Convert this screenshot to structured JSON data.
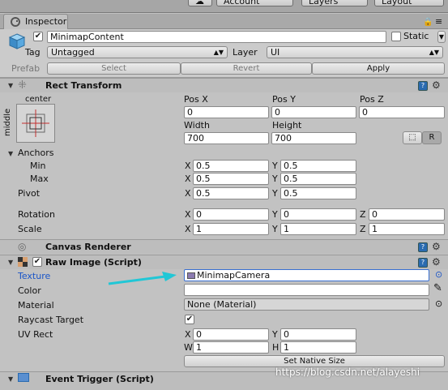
{
  "topbar": {
    "account": "Account",
    "layers": "Layers",
    "layout": "Layout"
  },
  "tab": {
    "label": "Inspector"
  },
  "header": {
    "object_name": "MinimapContent",
    "static_label": "Static",
    "tag_label": "Tag",
    "tag_value": "Untagged",
    "layer_label": "Layer",
    "layer_value": "UI",
    "prefab_label": "Prefab",
    "select_label": "Select",
    "revert_label": "Revert",
    "apply_label": "Apply"
  },
  "rect_transform": {
    "title": "Rect Transform",
    "anchor_h": "center",
    "anchor_v": "middle",
    "posx_label": "Pos X",
    "posy_label": "Pos Y",
    "posz_label": "Pos Z",
    "posx": "0",
    "posy": "0",
    "posz": "0",
    "width_label": "Width",
    "height_label": "Height",
    "width": "700",
    "height": "700",
    "r_label": "R",
    "anchors_label": "Anchors",
    "min_label": "Min",
    "max_label": "Max",
    "min_x": "0.5",
    "min_y": "0.5",
    "max_x": "0.5",
    "max_y": "0.5",
    "pivot_label": "Pivot",
    "pivot_x": "0.5",
    "pivot_y": "0.5",
    "rotation_label": "Rotation",
    "rot_x": "0",
    "rot_y": "0",
    "rot_z": "0",
    "scale_label": "Scale",
    "scale_x": "1",
    "scale_y": "1",
    "scale_z": "1",
    "x": "X",
    "y": "Y",
    "z": "Z"
  },
  "canvas_renderer": {
    "title": "Canvas Renderer"
  },
  "raw_image": {
    "title": "Raw Image (Script)",
    "texture_label": "Texture",
    "texture_value": "MinimapCamera",
    "color_label": "Color",
    "material_label": "Material",
    "material_value": "None (Material)",
    "raycast_label": "Raycast Target",
    "uvrect_label": "UV Rect",
    "uv_x": "0",
    "uv_y": "0",
    "uv_w": "1",
    "uv_h": "1",
    "w": "W",
    "h": "H",
    "set_native_size": "Set Native Size"
  },
  "event_trigger": {
    "title": "Event Trigger (Script)"
  },
  "watermark": "https://blog.csdn.net/alayeshi",
  "colors": {
    "arrow": "#21c7d6",
    "texture_label": "#1a55c8",
    "help": "#2a6bb0"
  }
}
